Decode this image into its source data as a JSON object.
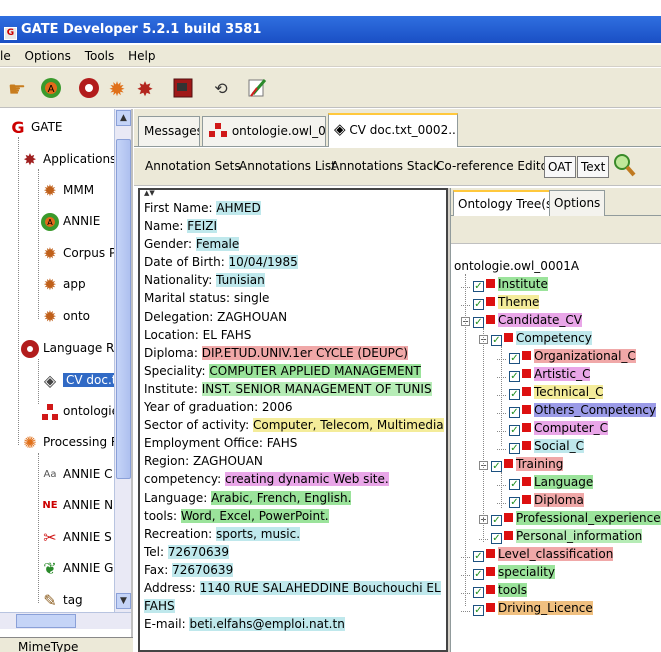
{
  "window": {
    "title": "GATE Developer 5.2.1 build 3581"
  },
  "menu": [
    "le",
    "Options",
    "Tools",
    "Help"
  ],
  "toolbar_icons": [
    "hand-icon",
    "annie-icon",
    "gate-app-icon",
    "gear-icon",
    "gear-red-icon",
    "book-icon",
    "restore-icon",
    "edit-icon"
  ],
  "left_tree": {
    "root": "GATE",
    "items": [
      {
        "label": "Applications",
        "level": 1,
        "icon": "gear-red-icon"
      },
      {
        "label": "MMM",
        "level": 2,
        "icon": "gear-icon"
      },
      {
        "label": "ANNIE",
        "level": 2,
        "icon": "annie-icon"
      },
      {
        "label": "Corpus P",
        "level": 2,
        "icon": "gear-icon"
      },
      {
        "label": "app",
        "level": 2,
        "icon": "gear-icon"
      },
      {
        "label": "onto",
        "level": 2,
        "icon": "gear-icon"
      },
      {
        "label": "Language R",
        "level": 1,
        "icon": "language-resource-icon"
      },
      {
        "label": "CV doc.t",
        "level": 2,
        "icon": "document-icon",
        "selected": true
      },
      {
        "label": "ontologie",
        "level": 2,
        "icon": "ontology-icon"
      },
      {
        "label": "Processing R",
        "level": 1,
        "icon": "processing-icon"
      },
      {
        "label": "ANNIE C",
        "level": 2,
        "icon": "tokeniser-icon"
      },
      {
        "label": "ANNIE N",
        "level": 2,
        "icon": "ne-icon"
      },
      {
        "label": "ANNIE S",
        "level": 2,
        "icon": "splitter-icon"
      },
      {
        "label": "ANNIE G",
        "level": 2,
        "icon": "gazetteer-icon"
      },
      {
        "label": "tag",
        "level": 2,
        "icon": "pen-icon"
      }
    ],
    "footer": "MimeType"
  },
  "tabs": [
    {
      "label": "Messages",
      "active": false
    },
    {
      "label": "ontologie.owl_0...",
      "active": false
    },
    {
      "label": "CV doc.txt_0002...",
      "active": true
    }
  ],
  "subtoolbar": {
    "annotation_sets": "Annotation Sets",
    "annotations_list": "Annotations List",
    "annotations_stack": "Annotations Stack",
    "coref_editor": "Co-reference Editor",
    "oat": "OAT",
    "text": "Text"
  },
  "document_lines": [
    [
      {
        "t": "First Name: "
      },
      {
        "t": "AHMED",
        "h": "cyan"
      }
    ],
    [
      {
        "t": "Name: "
      },
      {
        "t": "FEIZI",
        "h": "cyan"
      }
    ],
    [
      {
        "t": "Gender: "
      },
      {
        "t": "Female",
        "h": "cyan"
      }
    ],
    [
      {
        "t": "Date of Birth: "
      },
      {
        "t": "10/04/1985",
        "h": "cyan"
      }
    ],
    [
      {
        "t": "Nationality: "
      },
      {
        "t": "Tunisian",
        "h": "cyan"
      }
    ],
    [
      {
        "t": "Marital status: single"
      }
    ],
    [
      {
        "t": "Delegation: ZAGHOUAN"
      }
    ],
    [
      {
        "t": "Location: EL FAHS"
      }
    ],
    [
      {
        "t": "Diploma: "
      },
      {
        "t": "DIP.ETUD.UNIV.1er CYCLE (DEUPC)",
        "h": "pink"
      }
    ],
    [
      {
        "t": "Speciality: "
      },
      {
        "t": "COMPUTER APPLIED MANAGEMENT",
        "h": "green"
      }
    ],
    [
      {
        "t": "Institute: "
      },
      {
        "t": "INST. SENIOR MANAGEMENT OF TUNIS",
        "h": "ltgreen"
      }
    ],
    [
      {
        "t": "Year of graduation: 2006"
      }
    ],
    [
      {
        "t": "Sector of activity: "
      },
      {
        "t": "Computer, Telecom, Multimedia",
        "h": "yellow"
      }
    ],
    [
      {
        "t": "Employment Office: FAHS"
      }
    ],
    [
      {
        "t": "Region: ZAGHOUAN"
      }
    ],
    [
      {
        "t": "competency: "
      },
      {
        "t": "creating dynamic Web site.",
        "h": "mag"
      }
    ],
    [
      {
        "t": "Language: "
      },
      {
        "t": "Arabic, French, English.",
        "h": "green"
      }
    ],
    [
      {
        "t": "tools: "
      },
      {
        "t": "Word, Excel, PowerPoint.",
        "h": "green"
      }
    ],
    [
      {
        "t": "Recreation: "
      },
      {
        "t": "sports, music.",
        "h": "cyan"
      }
    ],
    [
      {
        "t": "Tel: "
      },
      {
        "t": "72670639",
        "h": "cyan"
      }
    ],
    [
      {
        "t": "Fax: "
      },
      {
        "t": "72670639",
        "h": "cyan"
      }
    ],
    [
      {
        "t": "Address: "
      },
      {
        "t": "1140 RUE SALAHEDDINE Bouchouchi EL",
        "h": "cyan"
      }
    ],
    [
      {
        "t": "FAHS",
        "h": "cyan"
      }
    ],
    [
      {
        "t": "E-mail: "
      },
      {
        "t": "beti.elfahs@emploi.nat.tn",
        "h": "cyan"
      }
    ]
  ],
  "ontology_tabs": [
    {
      "label": "Ontology Tree(s)",
      "active": true
    },
    {
      "label": "Options",
      "active": false
    }
  ],
  "ontology": {
    "root": "ontologie.owl_0001A",
    "nodes": [
      {
        "label": "Institute",
        "level": 1,
        "h": "green"
      },
      {
        "label": "Theme",
        "level": 1,
        "h": "yellow"
      },
      {
        "label": "Candidate_CV",
        "level": 1,
        "h": "mag",
        "expander": "minus"
      },
      {
        "label": "Competency",
        "level": 2,
        "h": "cyan",
        "expander": "minus"
      },
      {
        "label": "Organizational_C",
        "level": 3,
        "h": "pink"
      },
      {
        "label": "Artistic_C",
        "level": 3,
        "h": "mag"
      },
      {
        "label": "Technical_C",
        "level": 3,
        "h": "yellow"
      },
      {
        "label": "Others_Competency",
        "level": 3,
        "h": "purple"
      },
      {
        "label": "Computer_C",
        "level": 3,
        "h": "mag"
      },
      {
        "label": "Social_C",
        "level": 3,
        "h": "cyan"
      },
      {
        "label": "Training",
        "level": 2,
        "h": "pink",
        "expander": "minus"
      },
      {
        "label": "Language",
        "level": 3,
        "h": "green"
      },
      {
        "label": "Diploma",
        "level": 3,
        "h": "pink"
      },
      {
        "label": "Professional_experience",
        "level": 2,
        "h": "green",
        "expander": "plus"
      },
      {
        "label": "Personal_information",
        "level": 2,
        "h": "ltgreen"
      },
      {
        "label": "Level_classification",
        "level": 1,
        "h": "pink"
      },
      {
        "label": "speciality",
        "level": 1,
        "h": "green"
      },
      {
        "label": "tools",
        "level": 1,
        "h": "green"
      },
      {
        "label": "Driving_Licence",
        "level": 1,
        "h": "orange"
      }
    ]
  },
  "colors": {
    "cyan": "#bfe8ec",
    "green": "#9be39b",
    "ltgreen": "#b6ecb6",
    "yellow": "#f4ec9a",
    "pink": "#f0a8a8",
    "mag": "#e9a6e8",
    "purple": "#9b9be8",
    "orange": "#f0c080",
    "titlebar": "#2456d0",
    "selection": "#316ac5"
  }
}
